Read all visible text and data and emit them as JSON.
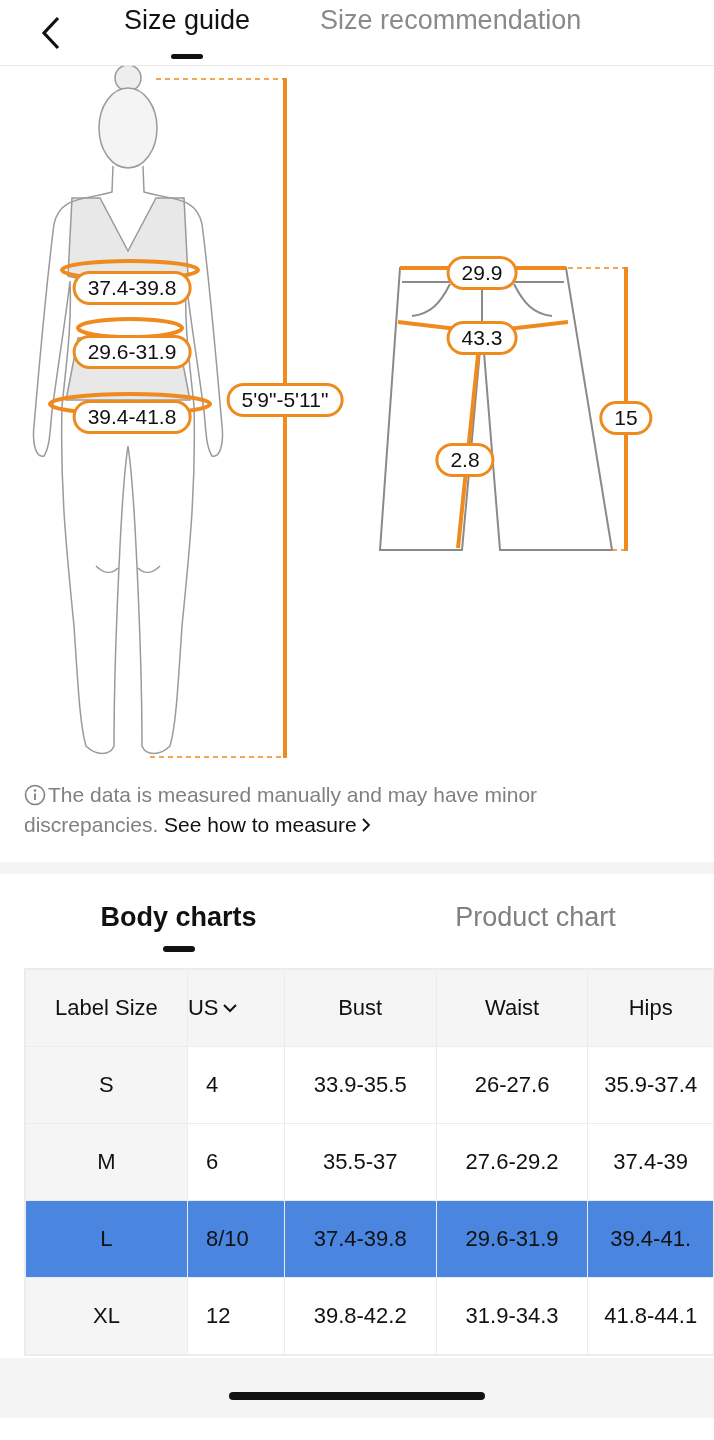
{
  "header": {
    "tabs": [
      {
        "label": "Size guide",
        "selected": true
      },
      {
        "label": "Size recommendation",
        "selected": false
      }
    ]
  },
  "body_figure": {
    "measurements": [
      {
        "kind": "bust",
        "value": "37.4-39.8"
      },
      {
        "kind": "waist",
        "value": "29.6-31.9"
      },
      {
        "kind": "hips",
        "value": "39.4-41.8"
      },
      {
        "kind": "height",
        "value": "5'9\"-5'11\""
      }
    ]
  },
  "garment_figure": {
    "measurements": [
      {
        "kind": "waist",
        "value": "29.9"
      },
      {
        "kind": "hip",
        "value": "43.3"
      },
      {
        "kind": "leg",
        "value": "2.8"
      },
      {
        "kind": "length",
        "value": "15"
      }
    ]
  },
  "note": {
    "text": "The data is measured manually and may have minor discrepancies.",
    "link": "See how to measure"
  },
  "chart_tabs": [
    {
      "label": "Body charts",
      "selected": true
    },
    {
      "label": "Product chart",
      "selected": false
    }
  ],
  "table": {
    "columns": [
      "Label Size",
      "US",
      "Bust",
      "Waist",
      "Hips"
    ],
    "rows": [
      {
        "cells": [
          "S",
          "4",
          "33.9-35.5",
          "26-27.6",
          "35.9-37.4"
        ],
        "selected": false
      },
      {
        "cells": [
          "M",
          "6",
          "35.5-37",
          "27.6-29.2",
          "37.4-39"
        ],
        "selected": false
      },
      {
        "cells": [
          "L",
          "8/10",
          "37.4-39.8",
          "29.6-31.9",
          "39.4-41."
        ],
        "selected": true
      },
      {
        "cells": [
          "XL",
          "12",
          "39.8-42.2",
          "31.9-34.3",
          "41.8-44.1"
        ],
        "selected": false
      }
    ]
  }
}
